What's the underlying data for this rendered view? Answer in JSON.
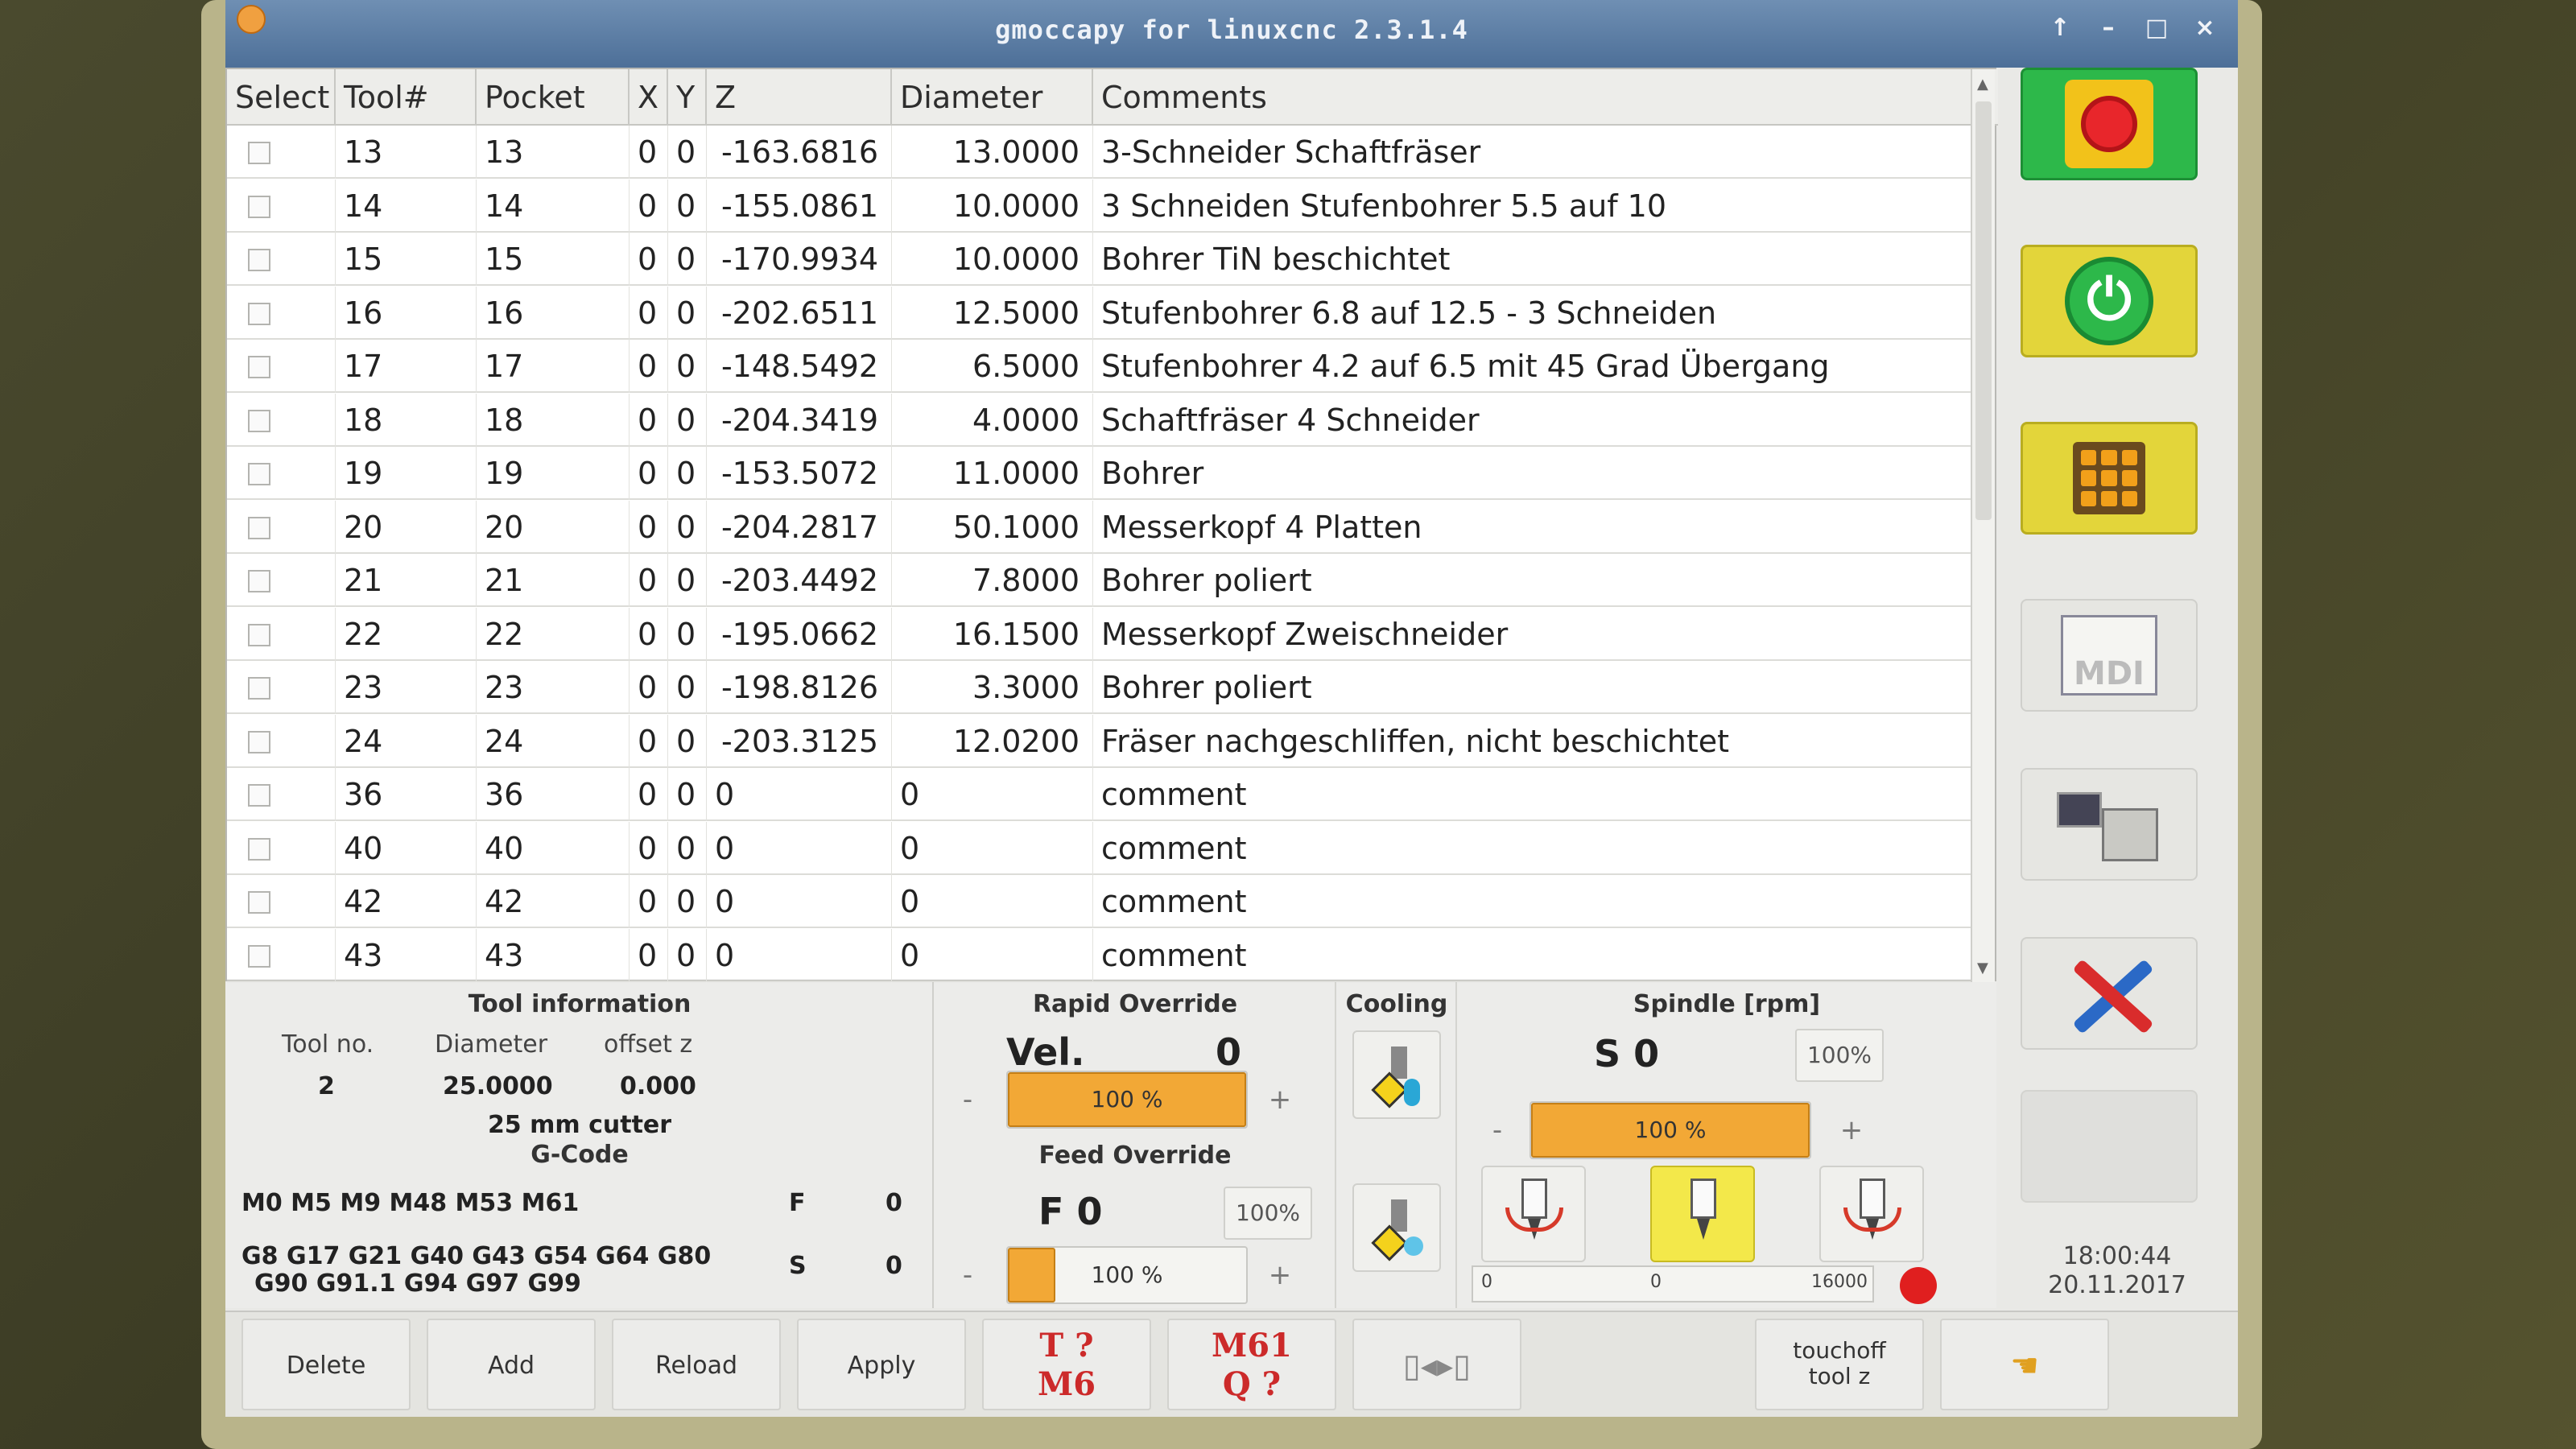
{
  "window": {
    "title": "gmoccapy for linuxcnc  2.3.1.4",
    "buttons": [
      "↑",
      "–",
      "□",
      "×"
    ]
  },
  "tool_table": {
    "columns": [
      "Select",
      "Tool#",
      "Pocket",
      "X",
      "Y",
      "Z",
      "Diameter",
      "Comments"
    ],
    "rows": [
      {
        "tool": "13",
        "pocket": "13",
        "x": "0",
        "y": "0",
        "z": "-163.6816",
        "diameter": "13.0000",
        "comment": "3-Schneider Schaftfräser"
      },
      {
        "tool": "14",
        "pocket": "14",
        "x": "0",
        "y": "0",
        "z": "-155.0861",
        "diameter": "10.0000",
        "comment": "3 Schneiden Stufenbohrer 5.5 auf 10"
      },
      {
        "tool": "15",
        "pocket": "15",
        "x": "0",
        "y": "0",
        "z": "-170.9934",
        "diameter": "10.0000",
        "comment": "Bohrer TiN beschichtet"
      },
      {
        "tool": "16",
        "pocket": "16",
        "x": "0",
        "y": "0",
        "z": "-202.6511",
        "diameter": "12.5000",
        "comment": "Stufenbohrer 6.8 auf 12.5 - 3 Schneiden"
      },
      {
        "tool": "17",
        "pocket": "17",
        "x": "0",
        "y": "0",
        "z": "-148.5492",
        "diameter": "6.5000",
        "comment": "Stufenbohrer 4.2 auf 6.5 mit 45 Grad Übergang"
      },
      {
        "tool": "18",
        "pocket": "18",
        "x": "0",
        "y": "0",
        "z": "-204.3419",
        "diameter": "4.0000",
        "comment": "Schaftfräser 4 Schneider"
      },
      {
        "tool": "19",
        "pocket": "19",
        "x": "0",
        "y": "0",
        "z": "-153.5072",
        "diameter": "11.0000",
        "comment": "Bohrer"
      },
      {
        "tool": "20",
        "pocket": "20",
        "x": "0",
        "y": "0",
        "z": "-204.2817",
        "diameter": "50.1000",
        "comment": "Messerkopf 4 Platten"
      },
      {
        "tool": "21",
        "pocket": "21",
        "x": "0",
        "y": "0",
        "z": "-203.4492",
        "diameter": "7.8000",
        "comment": "Bohrer poliert"
      },
      {
        "tool": "22",
        "pocket": "22",
        "x": "0",
        "y": "0",
        "z": "-195.0662",
        "diameter": "16.1500",
        "comment": "Messerkopf Zweischneider"
      },
      {
        "tool": "23",
        "pocket": "23",
        "x": "0",
        "y": "0",
        "z": "-198.8126",
        "diameter": "3.3000",
        "comment": "Bohrer poliert"
      },
      {
        "tool": "24",
        "pocket": "24",
        "x": "0",
        "y": "0",
        "z": "-203.3125",
        "diameter": "12.0200",
        "comment": "Fräser nachgeschliffen, nicht beschichtet"
      },
      {
        "tool": "36",
        "pocket": "36",
        "x": "0",
        "y": "0",
        "z": "0",
        "diameter": "0",
        "comment": "comment"
      },
      {
        "tool": "40",
        "pocket": "40",
        "x": "0",
        "y": "0",
        "z": "0",
        "diameter": "0",
        "comment": "comment"
      },
      {
        "tool": "42",
        "pocket": "42",
        "x": "0",
        "y": "0",
        "z": "0",
        "diameter": "0",
        "comment": "comment"
      },
      {
        "tool": "43",
        "pocket": "43",
        "x": "0",
        "y": "0",
        "z": "0",
        "diameter": "0",
        "comment": "comment"
      }
    ]
  },
  "tool_info": {
    "title": "Tool information",
    "labels": {
      "tool_no": "Tool no.",
      "diameter": "Diameter",
      "offset_z": "offset z"
    },
    "values": {
      "tool_no": "2",
      "diameter": "25.0000",
      "offset_z": "0.000"
    },
    "description": "25 mm cutter"
  },
  "gcode": {
    "title": "G-Code",
    "mcodes": "M0 M5 M9 M48 M53 M61",
    "gcodes_line1": "G8 G17 G21 G40 G43 G54 G64 G80",
    "gcodes_line2": "G90 G91.1 G94 G97 G99",
    "f_label": "F",
    "f_value": "0",
    "s_label": "S",
    "s_value": "0"
  },
  "rapid_override": {
    "title": "Rapid Override",
    "vel_label": "Vel.",
    "vel_value": "0",
    "slider_label": "100 %",
    "slider_fraction": 1.0,
    "minus": "-",
    "plus": "+"
  },
  "feed_override": {
    "title": "Feed Override",
    "f_display": "F  0",
    "pct_button": "100%",
    "slider_label": "100 %",
    "slider_fraction": 0.2,
    "minus": "-",
    "plus": "+"
  },
  "cooling": {
    "title": "Cooling"
  },
  "spindle": {
    "title": "Spindle [rpm]",
    "s_display": "S 0",
    "pct_button": "100%",
    "slider_label": "100 %",
    "minus": "-",
    "plus": "+",
    "rpm_min": "0",
    "rpm_current": "0",
    "rpm_max": "16000"
  },
  "status": {
    "time": "18:00:44",
    "date": "20.11.2017"
  },
  "bottom_buttons": {
    "delete": "Delete",
    "add": "Add",
    "reload": "Reload",
    "apply": "Apply",
    "t_change_1": "T ?",
    "t_change_2": "M6",
    "m61_1": "M61",
    "m61_2": "Q ?",
    "touchoff_1": "touchoff",
    "touchoff_2": "tool z"
  },
  "colors": {
    "accent": "#f2a836",
    "estop_bg": "#2db84a",
    "highlight": "#e3d53a",
    "red": "#cc2a2a"
  },
  "icons": [
    "estop-icon",
    "power-icon",
    "settings-icon",
    "mdi-icon",
    "auto-icon",
    "tool-settings-icon",
    "flood-icon",
    "mist-icon",
    "spindle-ccw-icon",
    "spindle-stop-icon",
    "spindle-cw-icon",
    "tool-measure-icon",
    "hand-icon"
  ]
}
